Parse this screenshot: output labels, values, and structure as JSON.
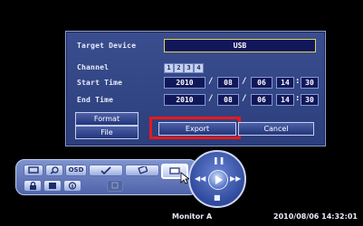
{
  "dialog": {
    "labels": {
      "target_device": "Target Device",
      "channel": "Channel",
      "start_time": "Start Time",
      "end_time": "End Time"
    },
    "target_device_value": "USB",
    "channels": [
      "1",
      "2",
      "3",
      "4"
    ],
    "start_time": {
      "year": "2010",
      "month": "08",
      "day": "06",
      "hour": "14",
      "minute": "30"
    },
    "end_time": {
      "year": "2010",
      "month": "08",
      "day": "06",
      "hour": "14",
      "minute": "30"
    },
    "date_separator": "/",
    "time_separator": ":",
    "buttons": {
      "format": "Format",
      "file": "File",
      "export": "Export",
      "cancel": "Cancel"
    }
  },
  "toolbar": {
    "osd_label": "OSD",
    "icons": [
      "fullscreen-icon",
      "zoom-icon",
      "osd-icon",
      "check-icon",
      "settings-icon",
      "export-icon",
      "lock-icon",
      "multiscreen-icon",
      "info-icon",
      "display-icon"
    ]
  },
  "nav_wheel": {
    "icons": [
      "pause-icon",
      "rewind-icon",
      "play-icon",
      "fast-forward-icon",
      "stop-icon"
    ]
  },
  "status": {
    "monitor_label": "Monitor A",
    "datetime": "2010/08/06 14:32:01"
  },
  "colors": {
    "dialog_bg": "#33478a",
    "highlight": "#e8181b",
    "device_border": "#e6d35a"
  }
}
